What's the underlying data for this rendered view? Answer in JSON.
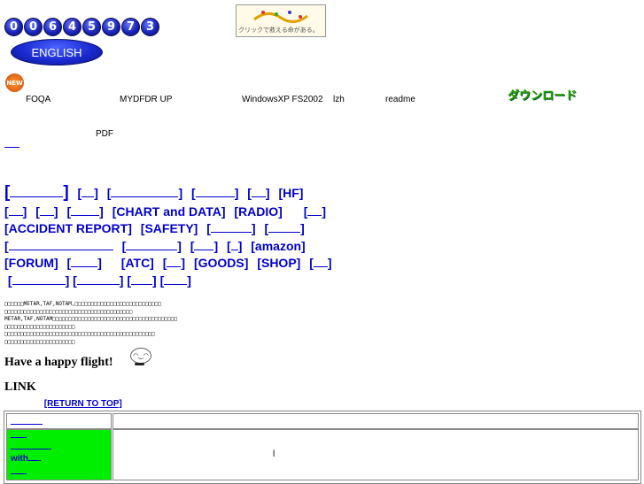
{
  "counter": {
    "digits": [
      "0",
      "0",
      "6",
      "4",
      "5",
      "9",
      "7",
      "3"
    ]
  },
  "language_button": {
    "label": "ENGLISH"
  },
  "banner": {
    "text": "クリックで救える命がある。"
  },
  "new_icon": {
    "label": "NEW"
  },
  "downloads": {
    "items": [
      "FOQA",
      "MYDFDR UP",
      "WindowsXP FS2002",
      "lzh",
      "readme"
    ],
    "download_label": "ダウンロード",
    "pdf_label": "PDF"
  },
  "nav": {
    "items": [
      "[HF]",
      "[CHART and DATA]",
      "[RADIO]",
      "[ACCIDENT REPORT]",
      "[SAFETY]",
      "[amazon]",
      "[FORUM]",
      "[ATC]",
      "[GOODS]",
      "[SHOP]"
    ]
  },
  "notes": {
    "lines": [
      "□□□□□□METAR,TAF,NOTAM,□□□□□□□□□□□□□□□□□□□□□□□□□□□",
      "□□□□□□□□□□□□□□□□□□□□□□□□□□□□□□□□□□□□□□□□",
      "METAR,TAF,NOTAM□□□□□□□□□□□□□□□□□□□□□□□□□□□□□□□□□□□□□□□",
      "□□□□□□□□□□□□□□□□□□□□□□",
      "□□□□□□□□□□□□□□□□□□□□□□□□□□□□□□□□□□□□□□□□□□□□□□□",
      "□□□□□□□□□□□□□□□□□□□□□□"
    ]
  },
  "greeting": {
    "text": "Have a happy flight!"
  },
  "links": {
    "heading": "LINK",
    "return_top": "[RETURN TO TOP]",
    "cell_with": "with",
    "cell_mark": "l"
  },
  "colors": {
    "link": "#0000cc",
    "highlight": "#00ee00"
  }
}
